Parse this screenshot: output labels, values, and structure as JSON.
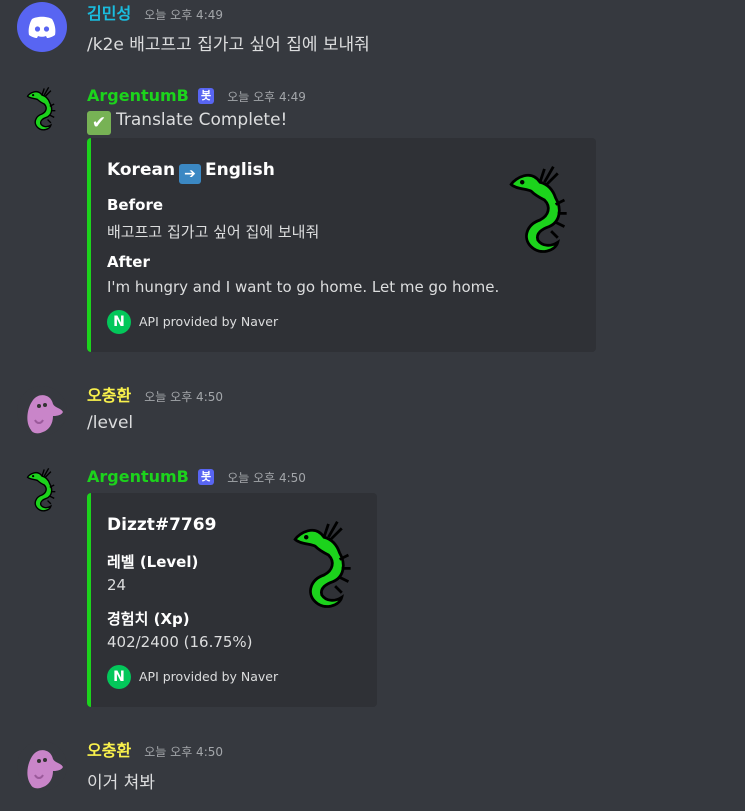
{
  "messages": [
    {
      "username": "김민성",
      "username_color": "#1abcde",
      "timestamp": "오늘 오후 4:49",
      "text": "/k2e 배고프고 집가고 싶어 집에 보내줘",
      "avatar_icon": "discord-logo-icon"
    },
    {
      "username": "ArgentumB",
      "username_color": "#1cd31c",
      "bot_tag": "봇",
      "timestamp": "오늘 오후 4:49",
      "text": "Translate Complete!",
      "status_icon": "check-mark-icon",
      "embed": {
        "title_left": "Korean",
        "title_right": "English",
        "title_icon": "right-arrow-icon",
        "fields": [
          {
            "name": "Before",
            "value": "배고프고 집가고 싶어 집에 보내줘"
          },
          {
            "name": "After",
            "value": "I'm hungry and I want to go home. Let me go home."
          }
        ],
        "footer_icon_letter": "N",
        "footer": "API provided by Naver",
        "accent": "#1cd31c"
      }
    },
    {
      "username": "오충환",
      "username_color": "#f9f14c",
      "timestamp": "오늘 오후 4:50",
      "text": "/level"
    },
    {
      "username": "ArgentumB",
      "username_color": "#1cd31c",
      "bot_tag": "봇",
      "timestamp": "오늘 오후 4:50",
      "embed": {
        "title": "Dizzt#7769",
        "fields": [
          {
            "name": "레벨 (Level)",
            "value": "24"
          },
          {
            "name": "경험치 (Xp)",
            "value": "402/2400 (16.75%)"
          }
        ],
        "footer_icon_letter": "N",
        "footer": "API provided by Naver"
      }
    },
    {
      "username": "오충환",
      "username_color": "#f9f14c",
      "timestamp": "오늘 오후 4:50",
      "text": "이거 쳐봐"
    }
  ]
}
